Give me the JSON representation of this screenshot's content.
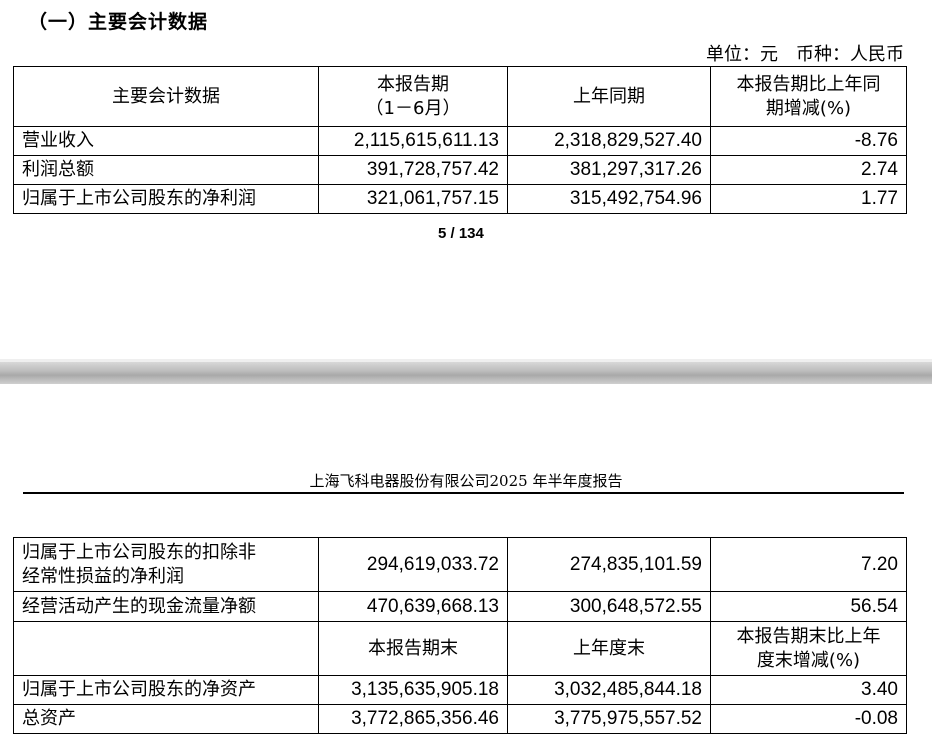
{
  "section_title": "（一）主要会计数据",
  "unit_line": "单位：元　币种：人民币",
  "table1": {
    "header": {
      "col1": "主要会计数据",
      "col2_line1": "本报告期",
      "col2_line2": "（1－6月）",
      "col3": "上年同期",
      "col4_line1": "本报告期比上年同",
      "col4_line2": "期增减(%)"
    },
    "rows": [
      {
        "label": "营业收入",
        "current": "2,115,615,611.13",
        "prior": "2,318,829,527.40",
        "change": "-8.76"
      },
      {
        "label": "利润总额",
        "current": "391,728,757.42",
        "prior": "381,297,317.26",
        "change": "2.74"
      },
      {
        "label": "归属于上市公司股东的净利润",
        "current": "321,061,757.15",
        "prior": "315,492,754.96",
        "change": "1.77"
      }
    ]
  },
  "page_number": "5 / 134",
  "report_header": "上海飞科电器股份有限公司2025 年半年度报告",
  "table2": {
    "rows_top": [
      {
        "label_line1": "归属于上市公司股东的扣除非",
        "label_line2": "经常性损益的净利润",
        "current": "294,619,033.72",
        "prior": "274,835,101.59",
        "change": "7.20"
      },
      {
        "label": "经营活动产生的现金流量净额",
        "current": "470,639,668.13",
        "prior": "300,648,572.55",
        "change": "56.54"
      }
    ],
    "subheader": {
      "col2": "本报告期末",
      "col3": "上年度末",
      "col4_line1": "本报告期末比上年",
      "col4_line2": "度末增减(%)"
    },
    "rows_bottom": [
      {
        "label": "归属于上市公司股东的净资产",
        "current": "3,135,635,905.18",
        "prior": "3,032,485,844.18",
        "change": "3.40"
      },
      {
        "label": "总资产",
        "current": "3,772,865,356.46",
        "prior": "3,775,975,557.52",
        "change": "-0.08"
      }
    ]
  }
}
